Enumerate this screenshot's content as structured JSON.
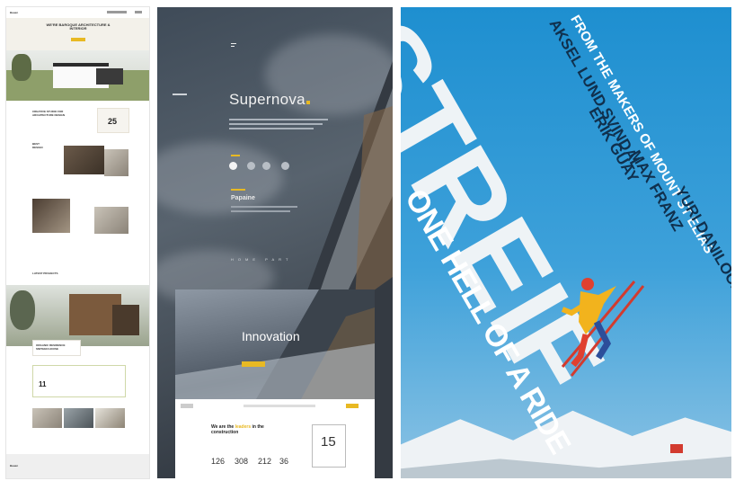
{
  "panel1": {
    "brand": "Bauen",
    "hero_title": "WE'RE BAROQUE ARCHITECTURE & INTERIOR",
    "stat_value": "25",
    "section_about": "CREATIVE STUDIO FOR ARCHITECTURE DESIGN",
    "section_last": "LATEST PROJECTS",
    "project_title": "ORGANIC RESIDENCE SMITHEN HOUSE",
    "stat2_value": "11"
  },
  "panel2": {
    "brand": "Supernova",
    "sub_title": "Papaine",
    "footer_caption": "HOME PART",
    "inno_title": "Innovation",
    "inno_button": "",
    "inno_heading_pre": "We are the ",
    "inno_heading_accent": "leaders",
    "inno_heading_post": " in the construction",
    "stats": [
      "126",
      "308",
      "212",
      "36"
    ],
    "badge": "15"
  },
  "poster": {
    "title_word": "STREIF",
    "tagline": "ONE HELL OF A RIDE",
    "credit_line": "FROM THE MAKERS OF MOUNT ST ELIAS",
    "cast": [
      "AKSEL LUND SVINDAL",
      "ERIK GUAY",
      "MAX FRANZ",
      "YURI DANILOCHKIN"
    ]
  },
  "colors": {
    "accent_yellow": "#e8b923",
    "poster_blue": "#1e8fd0",
    "dark_panel": "#3f4b58"
  }
}
